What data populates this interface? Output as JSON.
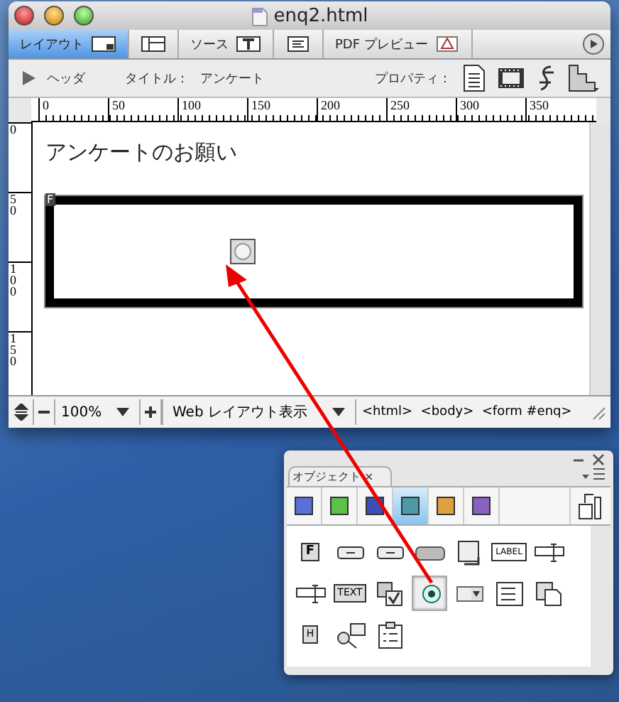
{
  "window": {
    "title": "enq2.html"
  },
  "tabs": [
    {
      "label": "レイアウト",
      "kind": "layout",
      "selected": true
    },
    {
      "kind": "split",
      "selected": false
    },
    {
      "label": "ソース",
      "kind": "source",
      "selected": false
    },
    {
      "kind": "list",
      "selected": false
    },
    {
      "label": "PDF プレビュー",
      "kind": "pdf",
      "selected": false
    }
  ],
  "toolbar": {
    "header_toggle": "ヘッダ",
    "title_label": "タイトル：",
    "title_value": "アンケート",
    "properties_label": "プロパティ："
  },
  "ruler": {
    "h_labels": [
      "0",
      "50",
      "100",
      "150",
      "200",
      "250",
      "300",
      "350"
    ],
    "v_labels": [
      "0",
      "50",
      "100",
      "150"
    ]
  },
  "document": {
    "heading": "アンケートのお願い",
    "form_marker": "F",
    "radio_selected": true
  },
  "status_bar": {
    "zoom": "100%",
    "view_mode": "Web レイアウト表示",
    "tag_path": "<html>  <body>  <form #enq>"
  },
  "palette": {
    "title": "オブジェクト",
    "close": "×",
    "categories": [
      {
        "color": "#5a6fd8",
        "selected": false
      },
      {
        "color": "#5fbf4a",
        "selected": false
      },
      {
        "color": "#3a4fb8",
        "selected": false
      },
      {
        "color": "#4a9aa8",
        "selected": true
      },
      {
        "color": "#e0a040",
        "selected": false
      },
      {
        "color": "#8a60c0",
        "selected": false
      }
    ],
    "items": [
      {
        "kind": "form",
        "label": "F",
        "selected": false
      },
      {
        "kind": "button",
        "selected": false
      },
      {
        "kind": "reset",
        "selected": false
      },
      {
        "kind": "pill",
        "selected": false
      },
      {
        "kind": "image",
        "selected": false
      },
      {
        "kind": "label",
        "label": "LABEL",
        "selected": false
      },
      {
        "kind": "field",
        "selected": false
      },
      {
        "kind": "password",
        "selected": false
      },
      {
        "kind": "textarea",
        "label": "TEXT",
        "selected": false
      },
      {
        "kind": "checkbox",
        "selected": false
      },
      {
        "kind": "radio",
        "selected": true
      },
      {
        "kind": "select",
        "selected": false
      },
      {
        "kind": "list",
        "selected": false
      },
      {
        "kind": "file",
        "selected": false
      },
      {
        "kind": "hidden",
        "label": "H",
        "selected": false
      },
      {
        "kind": "key",
        "selected": false
      },
      {
        "kind": "fieldset",
        "selected": false
      }
    ]
  }
}
